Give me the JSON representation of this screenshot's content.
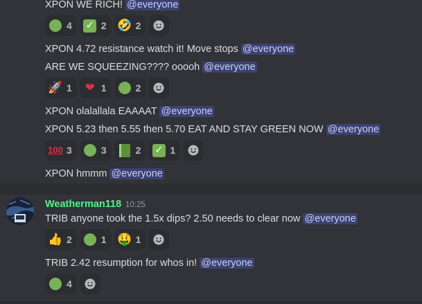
{
  "messages": [
    {
      "text": "XPON WE RICH! ",
      "mention": "@everyone"
    },
    {
      "text": "XPON 4.72 resistance watch it! Move stops ",
      "mention": "@everyone"
    },
    {
      "text": "ARE WE SQUEEZING???? ooooh ",
      "mention": "@everyone"
    },
    {
      "text": "XPON  olalallala EAAAAT ",
      "mention": "@everyone"
    },
    {
      "text": "XPON 5.23 then 5.55 then 5.70 EAT AND STAY GREEN NOW ",
      "mention": "@everyone"
    },
    {
      "text": "XPON hmmm ",
      "mention": "@everyone"
    },
    {
      "text": "TRIB anyone took the 1.5x dips? 2.50 needs to clear now ",
      "mention": "@everyone"
    },
    {
      "text": "TRIB 2.42 resumption for whos in! ",
      "mention": "@everyone"
    }
  ],
  "reactions": {
    "r1": [
      {
        "emoji": "green-circle",
        "count": "4"
      },
      {
        "emoji": "check-mark",
        "count": "2"
      },
      {
        "emoji": "rofl",
        "count": "2"
      }
    ],
    "r2": [
      {
        "emoji": "rocket",
        "count": "1"
      },
      {
        "emoji": "heart",
        "count": "1"
      },
      {
        "emoji": "green-circle",
        "count": "2"
      }
    ],
    "r3": [
      {
        "emoji": "hundred",
        "count": "3"
      },
      {
        "emoji": "green-circle",
        "count": "3"
      },
      {
        "emoji": "green-book",
        "count": "2"
      },
      {
        "emoji": "check-mark",
        "count": "1"
      }
    ],
    "r4": [
      {
        "emoji": "thumbs-up",
        "count": "2"
      },
      {
        "emoji": "green-circle",
        "count": "1"
      },
      {
        "emoji": "money-mouth",
        "count": "1"
      }
    ],
    "r5": [
      {
        "emoji": "green-circle",
        "count": "4"
      }
    ]
  },
  "author": {
    "name": "Weatherman118",
    "time": "10:25"
  },
  "glyphs": {
    "check": "✓",
    "rofl": "🤣",
    "rocket": "🚀",
    "heart": "❤",
    "hundred": "100",
    "thumbs": "👍",
    "money": "🤑"
  },
  "colors": {
    "background": "#313338",
    "mention_bg": "#3c4270",
    "username": "#57f287",
    "reaction_bg": "#2b2d31"
  }
}
